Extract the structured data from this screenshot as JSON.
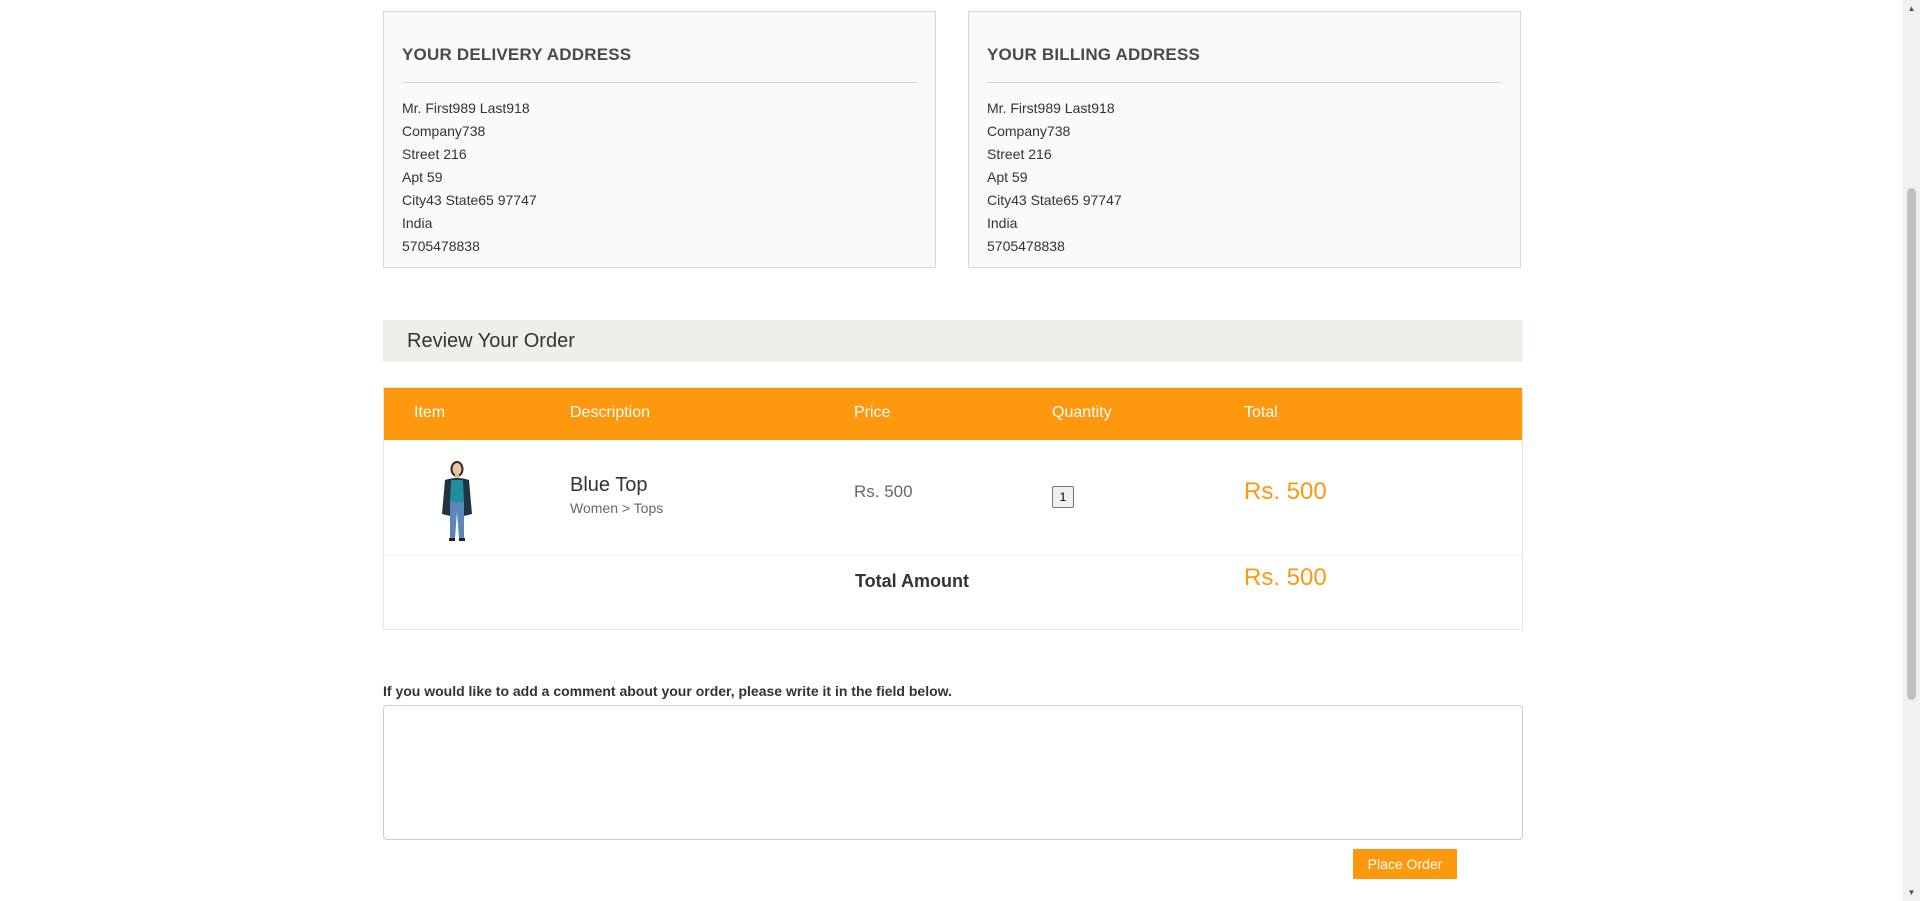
{
  "delivery": {
    "title": "Your delivery address",
    "lines": [
      "Mr. First989 Last918",
      "Company738",
      "Street 216",
      "Apt 59",
      "City43 State65 97747",
      "India",
      "5705478838"
    ]
  },
  "billing": {
    "title": "Your billing address",
    "lines": [
      "Mr. First989 Last918",
      "Company738",
      "Street 216",
      "Apt 59",
      "City43 State65 97747",
      "India",
      "5705478838"
    ]
  },
  "review": {
    "heading": "Review Your Order"
  },
  "cart": {
    "columns": [
      "Item",
      "Description",
      "Price",
      "Quantity",
      "Total"
    ],
    "rows": [
      {
        "name": "Blue Top",
        "category": "Women > Tops",
        "price": "Rs. 500",
        "quantity": "1",
        "total": "Rs. 500"
      }
    ],
    "total_label": "Total Amount",
    "total_amount": "Rs. 500"
  },
  "comment": {
    "label": "If you would like to add a comment about your order, please write it in the field below.",
    "value": ""
  },
  "actions": {
    "place_order": "Place Order"
  },
  "colors": {
    "accent": "#fe980f",
    "review_bg": "#efefe9",
    "address_bg": "#fafafa"
  }
}
